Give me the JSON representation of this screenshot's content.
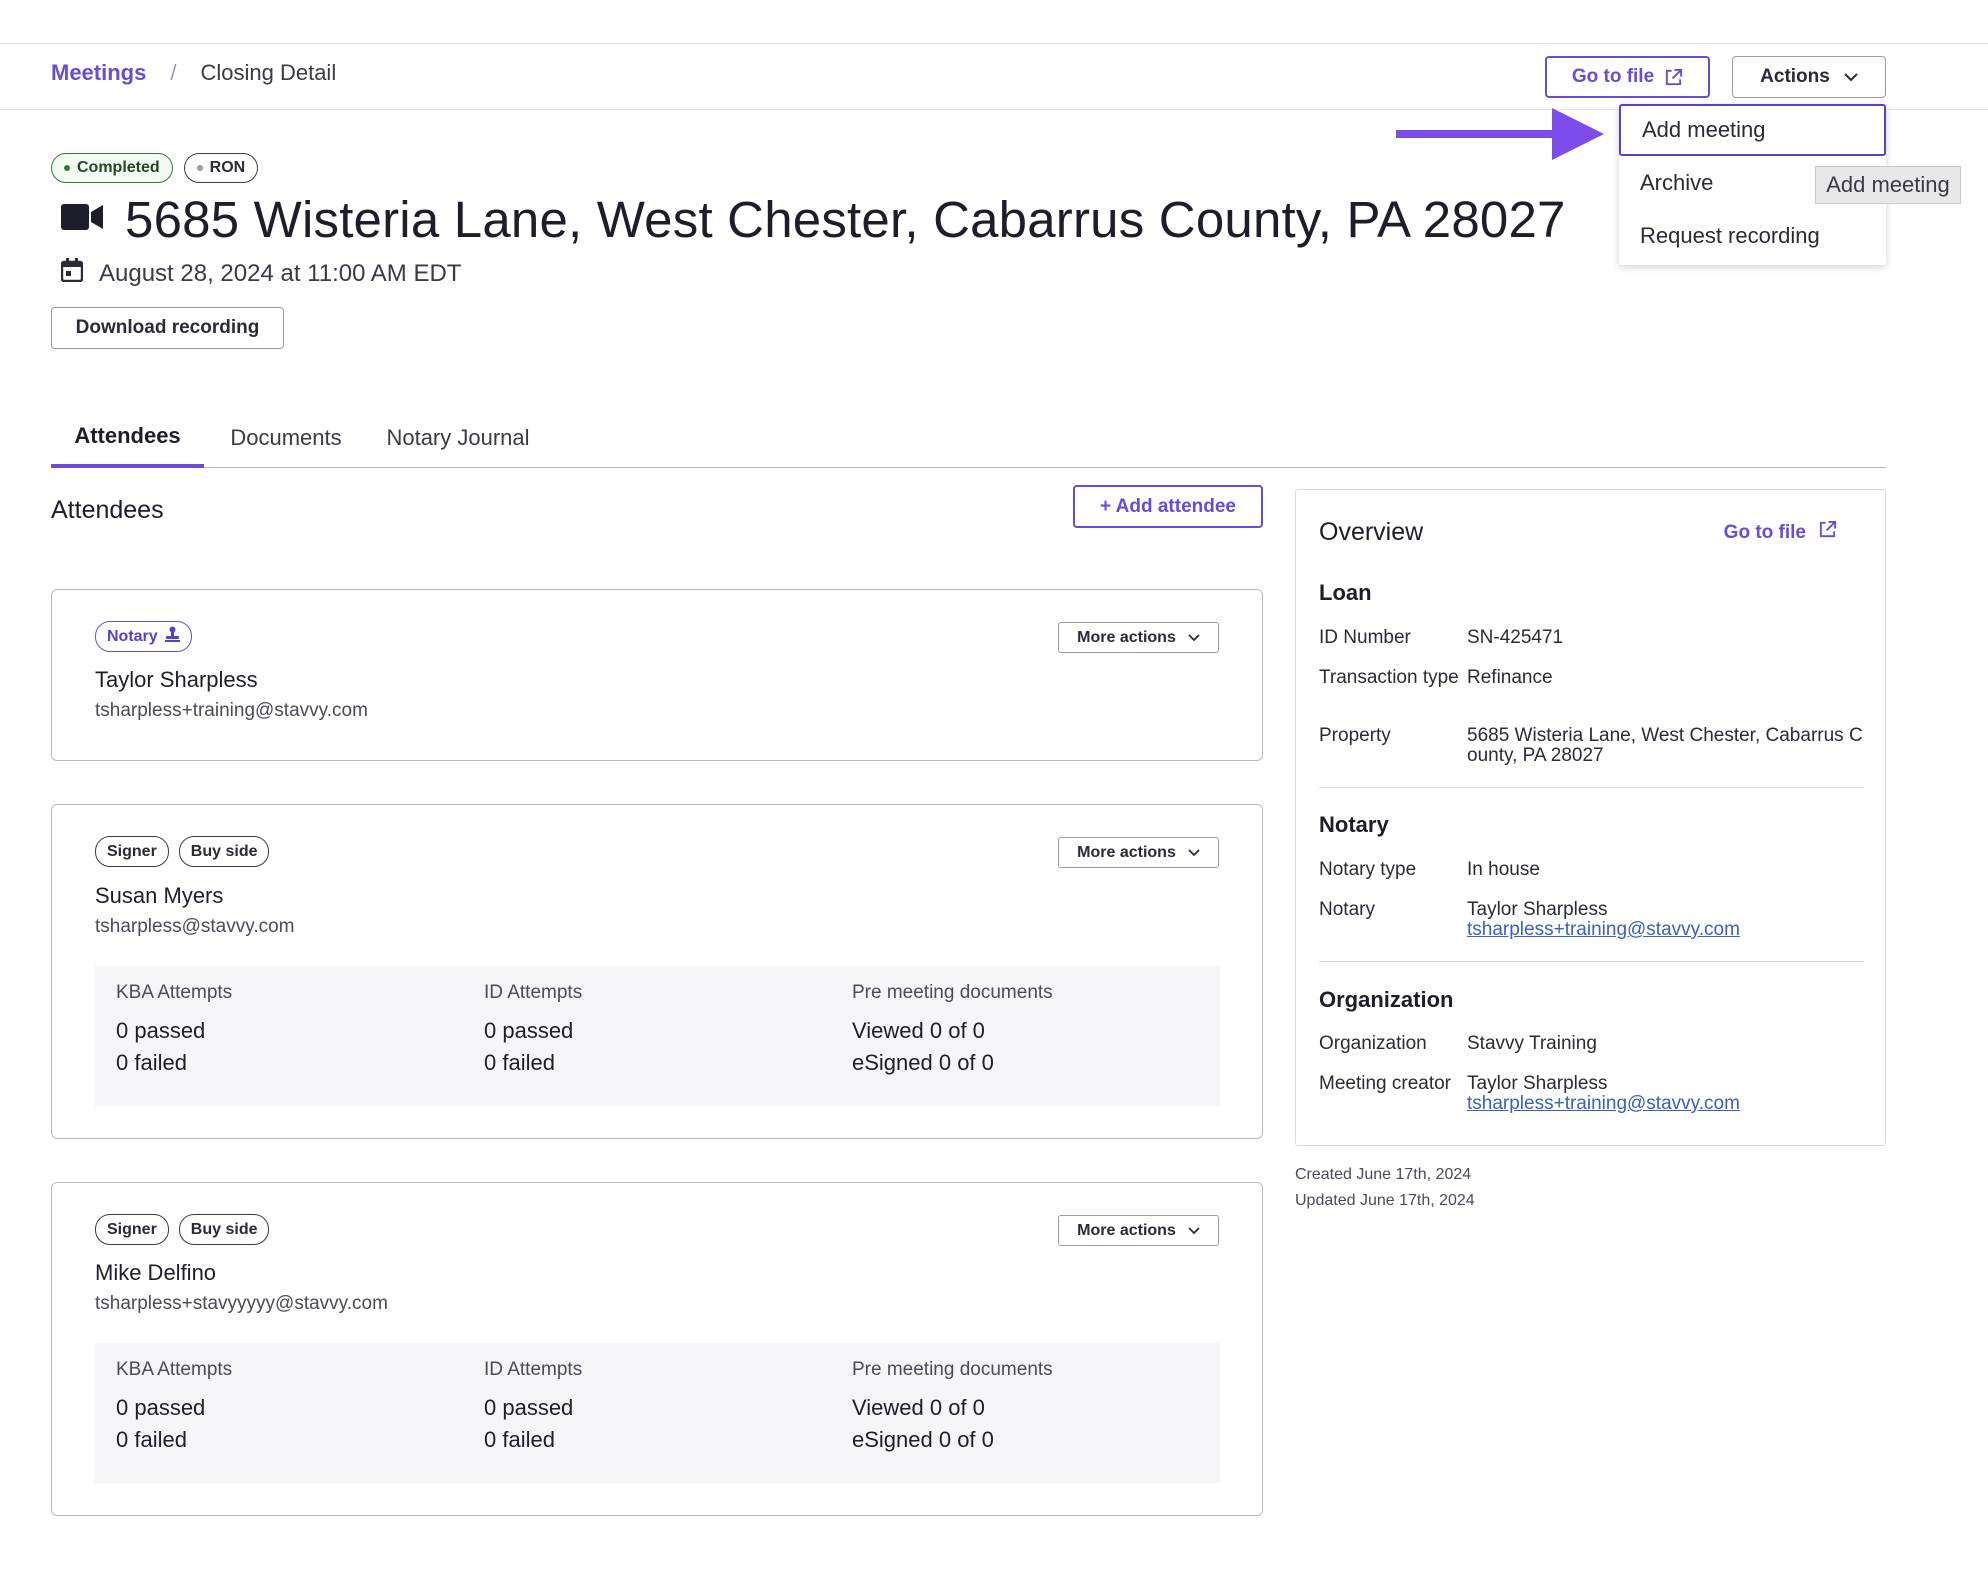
{
  "breadcrumb": {
    "parent": "Meetings",
    "separator": "/",
    "current": "Closing Detail"
  },
  "header": {
    "go_to_file": "Go to file",
    "actions": "Actions"
  },
  "actions_menu": {
    "items": [
      "Add meeting",
      "Archive",
      "Request recording"
    ],
    "active_index": 0
  },
  "tooltip": "Add meeting",
  "status_badges": [
    "Completed",
    "RON"
  ],
  "meeting": {
    "title": "5685 Wisteria Lane, West Chester, Cabarrus County, PA 28027",
    "datetime": "August 28, 2024 at 11:00 AM EDT",
    "download_label": "Download recording"
  },
  "tabs": [
    "Attendees",
    "Documents",
    "Notary Journal"
  ],
  "attendees_section": {
    "title": "Attendees",
    "add_label": "+ Add attendee",
    "more_actions": "More actions"
  },
  "attendees": [
    {
      "tags": [
        "Notary"
      ],
      "name": "Taylor Sharpless",
      "email": "tsharpless+training@stavvy.com"
    },
    {
      "tags": [
        "Signer",
        "Buy side"
      ],
      "name": "Susan Myers",
      "email": "tsharpless@stavvy.com",
      "stats": {
        "kba_head": "KBA Attempts",
        "kba_passed": "0 passed",
        "kba_failed": "0 failed",
        "id_head": "ID Attempts",
        "id_passed": "0 passed",
        "id_failed": "0 failed",
        "docs_head": "Pre meeting documents",
        "docs_viewed": "Viewed 0 of 0",
        "docs_signed": "eSigned 0 of 0"
      }
    },
    {
      "tags": [
        "Signer",
        "Buy side"
      ],
      "name": "Mike Delfino",
      "email": "tsharpless+stavyyyyy@stavvy.com",
      "stats": {
        "kba_head": "KBA Attempts",
        "kba_passed": "0 passed",
        "kba_failed": "0 failed",
        "id_head": "ID Attempts",
        "id_passed": "0 passed",
        "id_failed": "0 failed",
        "docs_head": "Pre meeting documents",
        "docs_viewed": "Viewed 0 of 0",
        "docs_signed": "eSigned 0 of 0"
      }
    }
  ],
  "overview": {
    "title": "Overview",
    "go_to_file": "Go to file",
    "loan": {
      "heading": "Loan",
      "id_label": "ID Number",
      "id_value": "SN-425471",
      "type_label": "Transaction type",
      "type_value": "Refinance",
      "property_label": "Property",
      "property_value": "5685 Wisteria Lane, West Chester, Cabarrus County, PA 28027"
    },
    "notary": {
      "heading": "Notary",
      "type_label": "Notary type",
      "type_value": "In house",
      "notary_label": "Notary",
      "notary_name": "Taylor Sharpless",
      "notary_email": "tsharpless+training@stavvy.com"
    },
    "organization": {
      "heading": "Organization",
      "org_label": "Organization",
      "org_value": "Stavvy Training",
      "creator_label": "Meeting creator",
      "creator_name": "Taylor Sharpless",
      "creator_email": "tsharpless+training@stavvy.com"
    }
  },
  "meta": {
    "created": "Created June 17th, 2024",
    "updated": "Updated June 17th, 2024"
  },
  "colors": {
    "accent": "#6a4bd6",
    "completed": "#2e7d32",
    "arrow": "#7c4dea"
  }
}
